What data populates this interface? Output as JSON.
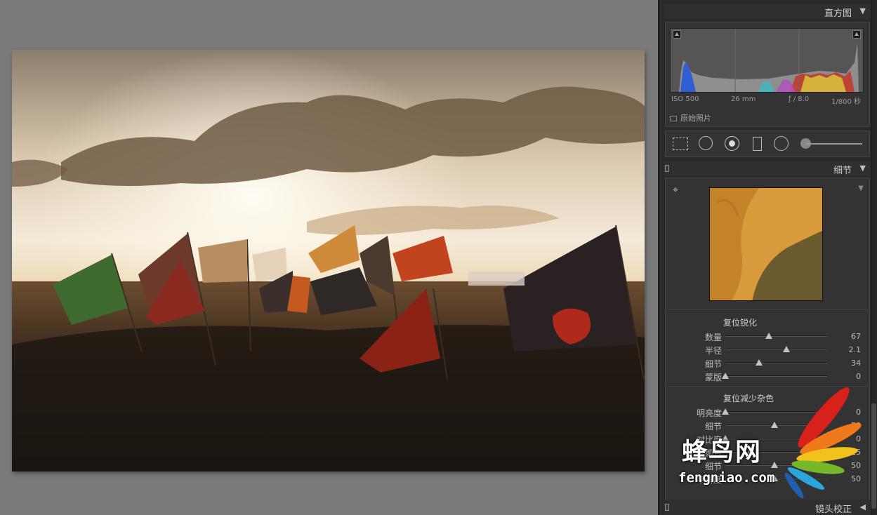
{
  "histogram": {
    "title": "直方图",
    "iso": "ISO 500",
    "focal": "26 mm",
    "aperture": "ƒ / 8.0",
    "shutter": "1/800 秒",
    "original_photo": "原始照片"
  },
  "tools": [
    "crop-overlay-icon",
    "spot-removal-icon",
    "red-eye-icon",
    "graduated-filter-icon",
    "radial-filter-icon",
    "adjustment-brush-icon"
  ],
  "detail": {
    "title": "细节",
    "sharpening": {
      "title": "复位锐化",
      "sliders": [
        {
          "label": "数量",
          "value": "67",
          "level": 0.44
        },
        {
          "label": "半径",
          "value": "2.1",
          "level": 0.62
        },
        {
          "label": "细节",
          "value": "34",
          "level": 0.34
        },
        {
          "label": "蒙版",
          "value": "0",
          "level": 0.0
        }
      ]
    },
    "noise_reduction": {
      "title": "复位减少杂色",
      "sliders": [
        {
          "label": "明亮度",
          "value": "0",
          "level": 0.0
        },
        {
          "label": "细节",
          "value": "50",
          "level": 0.5
        },
        {
          "label": "对比度",
          "value": "0",
          "level": 0.0
        },
        {
          "label": "颜色",
          "value": "25",
          "level": 0.25
        },
        {
          "label": "细节",
          "value": "50",
          "level": 0.5
        },
        {
          "label": "平滑度",
          "value": "50",
          "level": 0.5
        }
      ]
    }
  },
  "lens": {
    "title": "镜头校正"
  },
  "watermark": {
    "text": "蜂鸟网",
    "url": "fengniao.com"
  }
}
